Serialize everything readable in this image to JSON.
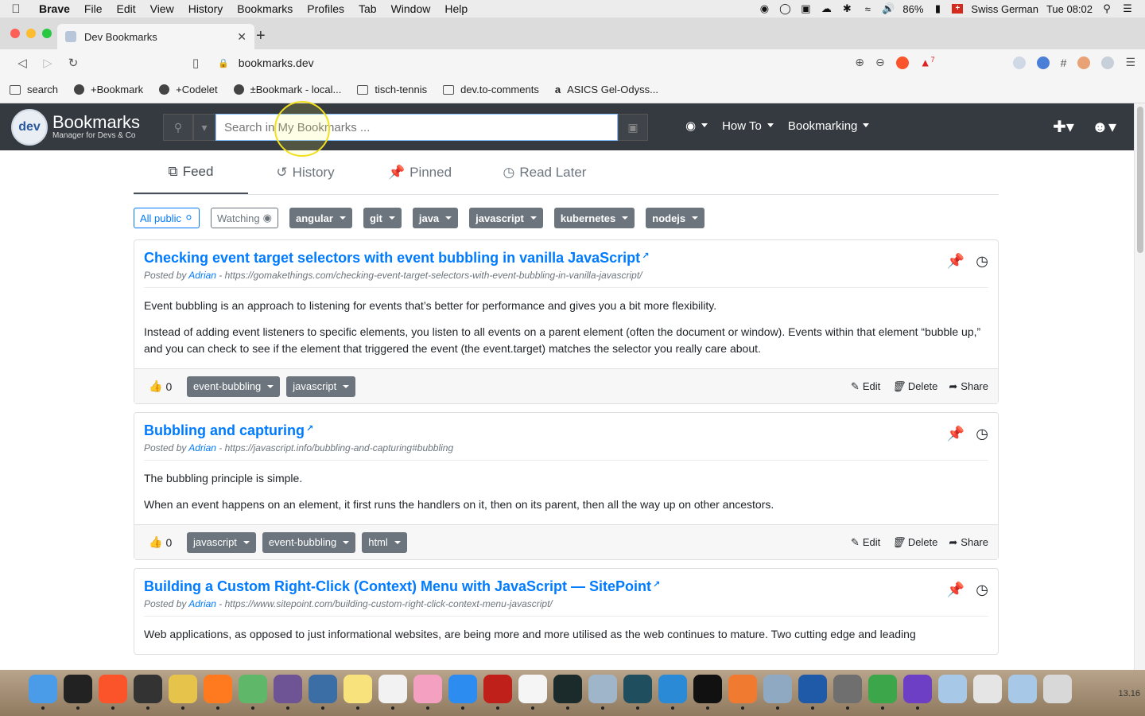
{
  "menubar": {
    "app": "Brave",
    "items": [
      "File",
      "Edit",
      "View",
      "History",
      "Bookmarks",
      "Profiles",
      "Tab",
      "Window",
      "Help"
    ],
    "battery": "86%",
    "keyboard": "Swiss German",
    "clock": "Tue 08:02"
  },
  "browser": {
    "tab_title": "Dev Bookmarks",
    "url": "bookmarks.dev",
    "brave_badge": "7",
    "bookmarks_bar": [
      {
        "label": "search",
        "icon": "folder-icon"
      },
      {
        "label": "+Bookmark",
        "icon": "globe-icon"
      },
      {
        "label": "+Codelet",
        "icon": "globe-icon"
      },
      {
        "label": "±Bookmark - local...",
        "icon": "globe-icon"
      },
      {
        "label": "tisch-tennis",
        "icon": "folder-icon"
      },
      {
        "label": "dev.to-comments",
        "icon": "folder-icon"
      },
      {
        "label": "ASICS Gel-Odyss...",
        "icon": "amazon-icon"
      }
    ]
  },
  "site": {
    "logo_badge": "dev",
    "logo_title": "Bookmarks",
    "logo_subtitle": "Manager for Devs & Co",
    "search_placeholder": "Search in My Bookmarks ...",
    "nav": {
      "howto": "How To",
      "bookmarking": "Bookmarking"
    }
  },
  "tabs": [
    {
      "label": "Feed",
      "icon": "share-icon",
      "active": true
    },
    {
      "label": "History",
      "icon": "history-icon",
      "active": false
    },
    {
      "label": "Pinned",
      "icon": "pin-icon",
      "active": false
    },
    {
      "label": "Read Later",
      "icon": "clock-icon",
      "active": false
    }
  ],
  "filters": {
    "all_public": "All public",
    "watching": "Watching",
    "tags": [
      "angular",
      "git",
      "java",
      "javascript",
      "kubernetes",
      "nodejs"
    ]
  },
  "cards": [
    {
      "title": "Checking event target selectors with event bubbling in vanilla JavaScript",
      "posted_by_label": "Posted by",
      "author": "Adrian",
      "url": "https://gomakethings.com/checking-event-target-selectors-with-event-bubbling-in-vanilla-javascript/",
      "paragraphs": [
        "Event bubbling is an approach to listening for events that’s better for performance and gives you a bit more flexibility.",
        "Instead of adding event listeners to specific elements, you listen to all events on a parent element (often the document or window). Events within that element “bubble up,” and you can check to see if the element that triggered the event (the event.target) matches the selector you really care about."
      ],
      "likes": "0",
      "tags": [
        "event-bubbling",
        "javascript"
      ]
    },
    {
      "title": "Bubbling and capturing",
      "posted_by_label": "Posted by",
      "author": "Adrian",
      "url": "https://javascript.info/bubbling-and-capturing#bubbling",
      "paragraphs": [
        "The bubbling principle is simple.",
        "When an event happens on an element, it first runs the handlers on it, then on its parent, then all the way up on other ancestors."
      ],
      "likes": "0",
      "tags": [
        "javascript",
        "event-bubbling",
        "html"
      ]
    },
    {
      "title": "Building a Custom Right-Click (Context) Menu with JavaScript — SitePoint",
      "posted_by_label": "Posted by",
      "author": "Adrian",
      "url": "https://www.sitepoint.com/building-custom-right-click-context-menu-javascript/",
      "paragraphs": [
        "Web applications, as opposed to just informational websites, are being more and more utilised as the web continues to mature. Two cutting edge and leading"
      ]
    }
  ],
  "card_actions": {
    "edit": "Edit",
    "delete": "Delete",
    "share": "Share"
  },
  "dock": {
    "version": "13.16"
  }
}
